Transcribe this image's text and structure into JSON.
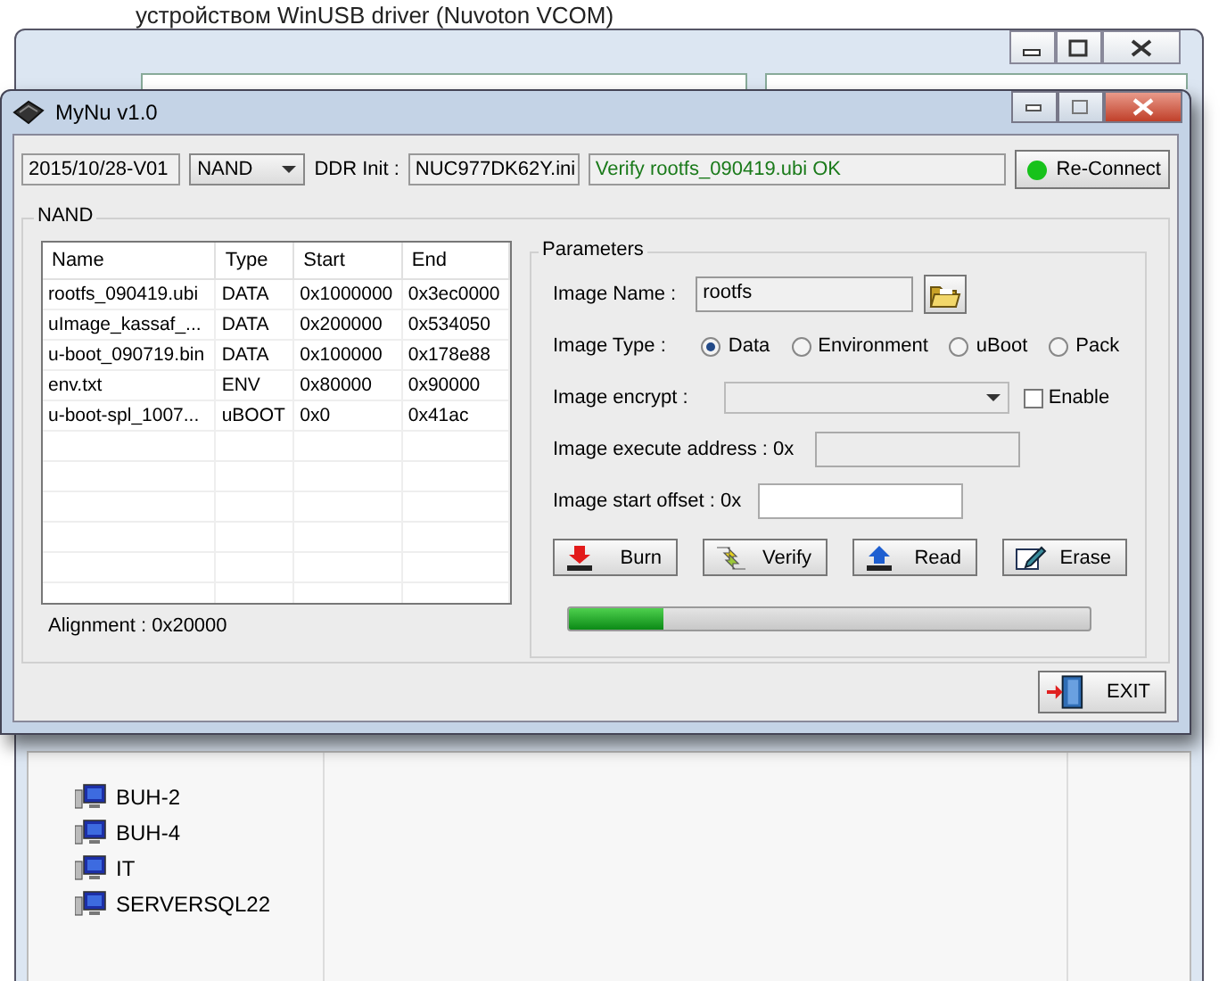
{
  "background_window": {
    "title_fragment": "устройством WinUSB driver (Nuvoton VCOM)",
    "tree": [
      {
        "label": "BUH-2"
      },
      {
        "label": "BUH-4"
      },
      {
        "label": "IT"
      },
      {
        "label": "SERVERSQL22"
      }
    ]
  },
  "window": {
    "title": "MyNu v1.0"
  },
  "toolbar": {
    "version": "2015/10/28-V01",
    "mode": "NAND",
    "ddr_label": "DDR Init :",
    "ddr_file": "NUC977DK62Y.ini",
    "status": "Verify rootfs_090419.ubi OK",
    "connected": true,
    "connect_button": "Re-Connect"
  },
  "nand": {
    "title": "NAND",
    "table": {
      "columns": [
        "Name",
        "Type",
        "Start",
        "End"
      ],
      "rows": [
        [
          "rootfs_090419.ubi",
          "DATA",
          "0x1000000",
          "0x3ec0000"
        ],
        [
          "uImage_kassaf_...",
          "DATA",
          "0x200000",
          "0x534050"
        ],
        [
          "u-boot_090719.bin",
          "DATA",
          "0x100000",
          "0x178e88"
        ],
        [
          "env.txt",
          "ENV",
          "0x80000",
          "0x90000"
        ],
        [
          "u-boot-spl_1007...",
          "uBOOT",
          "0x0",
          "0x41ac"
        ]
      ]
    },
    "alignment": "Alignment : 0x20000"
  },
  "parameters": {
    "title": "Parameters",
    "image_name_label": "Image Name :",
    "image_name": "rootfs",
    "image_type_label": "Image Type :",
    "image_types": [
      {
        "label": "Data",
        "selected": true
      },
      {
        "label": "Environment",
        "selected": false
      },
      {
        "label": "uBoot",
        "selected": false
      },
      {
        "label": "Pack",
        "selected": false
      }
    ],
    "encrypt_label": "Image encrypt :",
    "encrypt_field": {
      "disabled": true
    },
    "encrypt_enable": {
      "label": "Enable",
      "checked": false
    },
    "exec_label": "Image execute address : 0x",
    "exec_field": {
      "disabled": true
    },
    "offset_label": "Image start offset : 0x",
    "offset_field": {
      "disabled": false
    },
    "actions": [
      {
        "label": "Burn",
        "kind": "burn"
      },
      {
        "label": "Verify",
        "kind": "verify"
      },
      {
        "label": "Read",
        "kind": "read"
      },
      {
        "label": "Erase",
        "kind": "erase"
      }
    ],
    "progress": {
      "level": 0.18
    }
  },
  "exit_button": "EXIT"
}
